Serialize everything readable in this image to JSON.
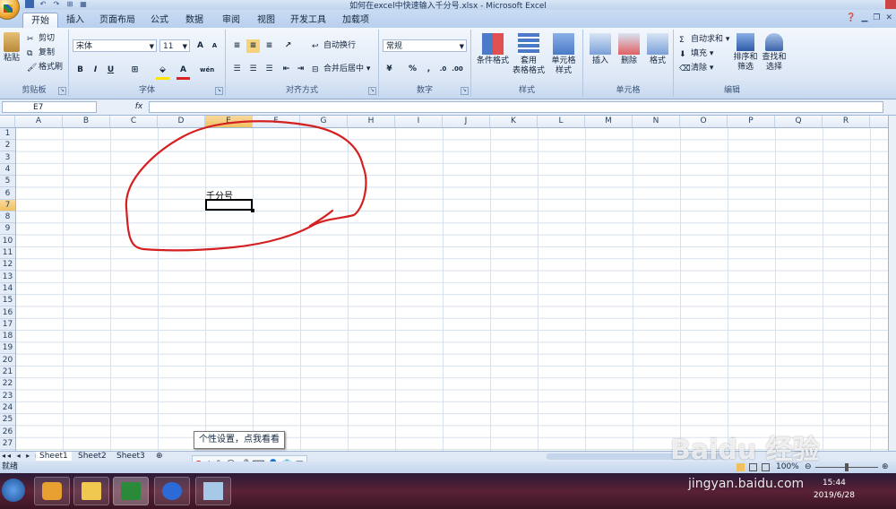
{
  "window": {
    "title": "如何在excel中快速输入千分号.xlsx - Microsoft Excel"
  },
  "tabs": [
    {
      "label": "开始",
      "active": true
    },
    {
      "label": "插入"
    },
    {
      "label": "页面布局"
    },
    {
      "label": "公式"
    },
    {
      "label": "数据"
    },
    {
      "label": "审阅"
    },
    {
      "label": "视图"
    },
    {
      "label": "开发工具"
    },
    {
      "label": "加载项"
    }
  ],
  "ribbon": {
    "clipboard": {
      "paste": "粘贴",
      "cut": "剪切",
      "copy": "复制",
      "format_painter": "格式刷",
      "label": "剪贴板"
    },
    "font": {
      "name": "宋体",
      "size": "11",
      "grow": "A",
      "shrink": "A",
      "bold": "B",
      "italic": "I",
      "underline": "U",
      "label": "字体",
      "phonetic": "wén"
    },
    "alignment": {
      "wrap": "自动换行",
      "merge": "合并后居中",
      "label": "对齐方式"
    },
    "number": {
      "format": "常规",
      "percent": "%",
      "comma": ",",
      "label": "数字"
    },
    "styles": {
      "conditional": "条件格式",
      "table_1": "套用",
      "table_2": "表格格式",
      "cell_styles_1": "单元格",
      "cell_styles_2": "样式",
      "label": "样式"
    },
    "cells": {
      "insert": "插入",
      "delete": "删除",
      "format": "格式",
      "label": "单元格"
    },
    "editing": {
      "autosum": "自动求和",
      "fill": "填充",
      "clear": "清除",
      "sort_1": "排序和",
      "sort_2": "筛选",
      "find_1": "查找和",
      "find_2": "选择",
      "label": "编辑"
    }
  },
  "formula_bar": {
    "name_box": "E7",
    "fx": "fx",
    "value": ""
  },
  "grid": {
    "columns": [
      "A",
      "B",
      "C",
      "D",
      "E",
      "F",
      "G",
      "H",
      "I",
      "J",
      "K",
      "L",
      "M",
      "N",
      "O",
      "P",
      "Q",
      "R"
    ],
    "selected_column": "E",
    "rows": [
      "1",
      "2",
      "3",
      "4",
      "5",
      "6",
      "7",
      "8",
      "9",
      "10",
      "11",
      "12",
      "13",
      "14",
      "15",
      "16",
      "17",
      "18",
      "19",
      "20",
      "21",
      "22",
      "23",
      "24",
      "25",
      "26",
      "27"
    ],
    "selected_row": "7",
    "cell_e6": "千分号",
    "active_cell": "E7"
  },
  "sheets": [
    "Sheet1",
    "Sheet2",
    "Sheet3"
  ],
  "status": {
    "mode": "就绪",
    "zoom": "100%"
  },
  "ime": {
    "lang": "中",
    "tooltip": "个性设置，点我看看"
  },
  "taskbar": {
    "time": "15:44",
    "date": "2019/6/28"
  },
  "watermark": {
    "brand": "Baidu 经验",
    "url": "jingyan.baidu.com"
  },
  "colors": {
    "accent": "#f1c15f",
    "annotation": "#d42020",
    "ribbon": "#dde8f6"
  }
}
